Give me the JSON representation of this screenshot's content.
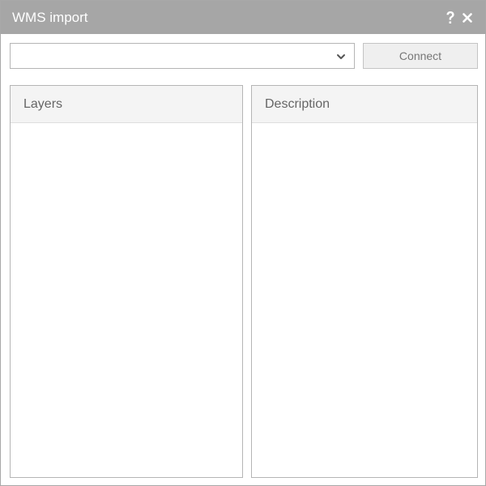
{
  "window": {
    "title": "WMS import",
    "help_icon": "help-icon",
    "close_icon": "close-icon"
  },
  "server_select": {
    "selected_value": "",
    "icon": "chevron-down-icon"
  },
  "toolbar": {
    "connect_label": "Connect"
  },
  "layers_panel": {
    "title": "Layers",
    "items": []
  },
  "description_panel": {
    "title": "Description",
    "text": ""
  },
  "colors": {
    "titlebar": "#a6a6a6",
    "panel_header": "#f4f4f4",
    "button_bg": "#efefef"
  }
}
